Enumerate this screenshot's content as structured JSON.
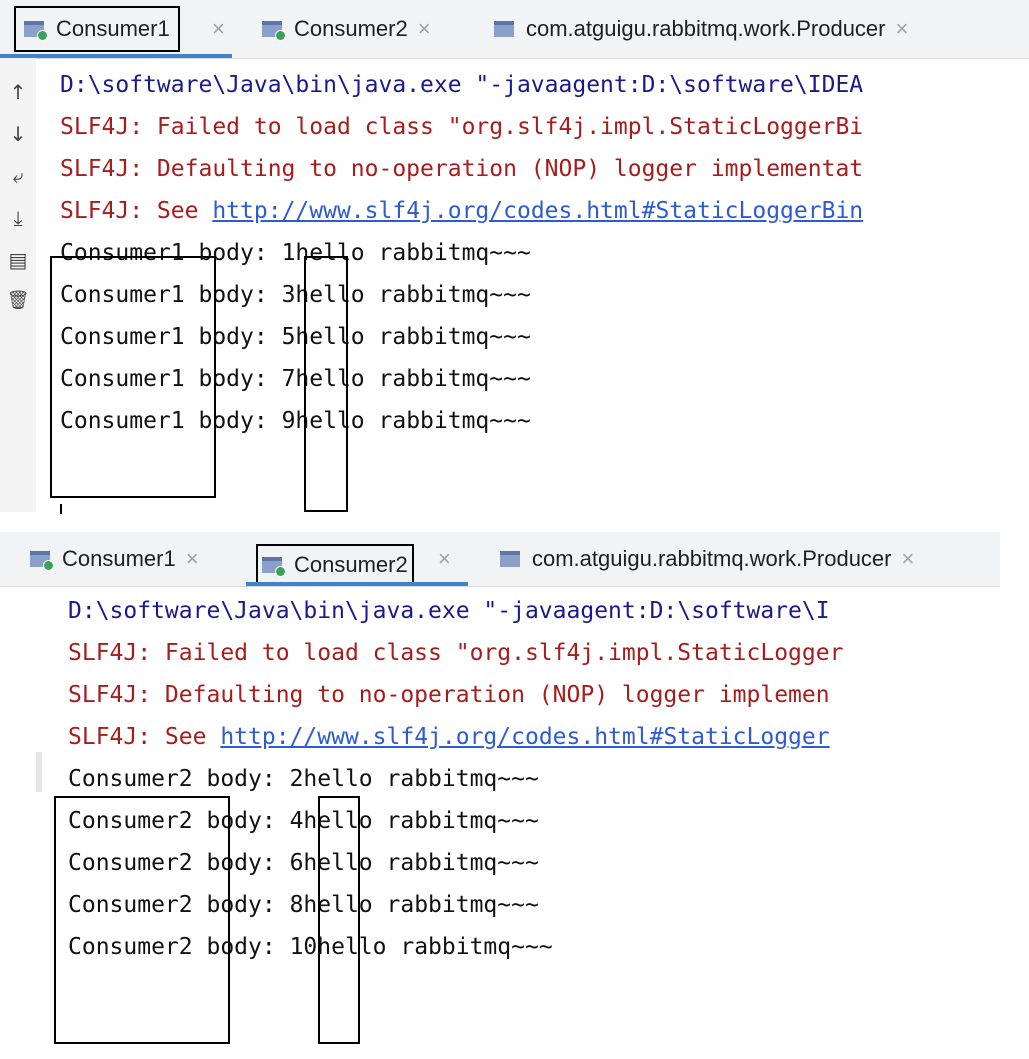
{
  "panel1": {
    "tabs": [
      {
        "label": "Consumer1",
        "close": "×",
        "active": true
      },
      {
        "label": "Consumer2",
        "close": "×",
        "active": false
      },
      {
        "label": "com.atguigu.rabbitmq.work.Producer",
        "close": "×",
        "active": false
      }
    ],
    "gutter_icons": [
      {
        "name": "up-arrow-icon",
        "glyph": "↑"
      },
      {
        "name": "down-arrow-icon",
        "glyph": "↓"
      },
      {
        "name": "soft-wrap-icon",
        "glyph": "⤶"
      },
      {
        "name": "scroll-to-end-icon",
        "glyph": "⤓"
      },
      {
        "name": "print-icon",
        "glyph": "▤"
      },
      {
        "name": "clear-icon",
        "glyph": "🗑"
      }
    ],
    "header_lines": {
      "cmd": "D:\\software\\Java\\bin\\java.exe \"-javaagent:D:\\software\\IDEA",
      "err1": "SLF4J: Failed to load class \"org.slf4j.impl.StaticLoggerBi",
      "err2": "SLF4J: Defaulting to no-operation (NOP) logger implementat",
      "see_prefix": "SLF4J: See ",
      "see_link": "http://www.slf4j.org/codes.html#StaticLoggerBin"
    },
    "rows": [
      {
        "consumer": "Consumer1",
        "body": " body: ",
        "num": "1",
        "msg": "hello rabbitmq~~~"
      },
      {
        "consumer": "Consumer1",
        "body": " body: ",
        "num": "3",
        "msg": "hello rabbitmq~~~"
      },
      {
        "consumer": "Consumer1",
        "body": " body: ",
        "num": "5",
        "msg": "hello rabbitmq~~~"
      },
      {
        "consumer": "Consumer1",
        "body": " body: ",
        "num": "7",
        "msg": "hello rabbitmq~~~"
      },
      {
        "consumer": "Consumer1",
        "body": " body: ",
        "num": "9",
        "msg": "hello rabbitmq~~~"
      }
    ]
  },
  "panel2": {
    "tabs": [
      {
        "label": "Consumer1",
        "close": "×",
        "active": false
      },
      {
        "label": "Consumer2",
        "close": "×",
        "active": true
      },
      {
        "label": "com.atguigu.rabbitmq.work.Producer",
        "close": "×",
        "active": false
      }
    ],
    "header_lines": {
      "cmd": "D:\\software\\Java\\bin\\java.exe \"-javaagent:D:\\software\\I",
      "err1": "SLF4J: Failed to load class \"org.slf4j.impl.StaticLogger",
      "err2": "SLF4J: Defaulting to no-operation (NOP) logger implemen",
      "see_prefix": "SLF4J: See ",
      "see_link": "http://www.slf4j.org/codes.html#StaticLogger"
    },
    "rows": [
      {
        "consumer": "Consumer2",
        "body": " body: ",
        "num": "2",
        "msg": "hello rabbitmq~~~"
      },
      {
        "consumer": "Consumer2",
        "body": " body: ",
        "num": "4",
        "msg": "hello rabbitmq~~~"
      },
      {
        "consumer": "Consumer2",
        "body": " body: ",
        "num": "6",
        "msg": "hello rabbitmq~~~"
      },
      {
        "consumer": "Consumer2",
        "body": " body: ",
        "num": "8",
        "msg": "hello rabbitmq~~~"
      },
      {
        "consumer": "Consumer2",
        "body": " body: ",
        "num": "10",
        "msg": "hello rabbitmq~~~"
      }
    ]
  }
}
